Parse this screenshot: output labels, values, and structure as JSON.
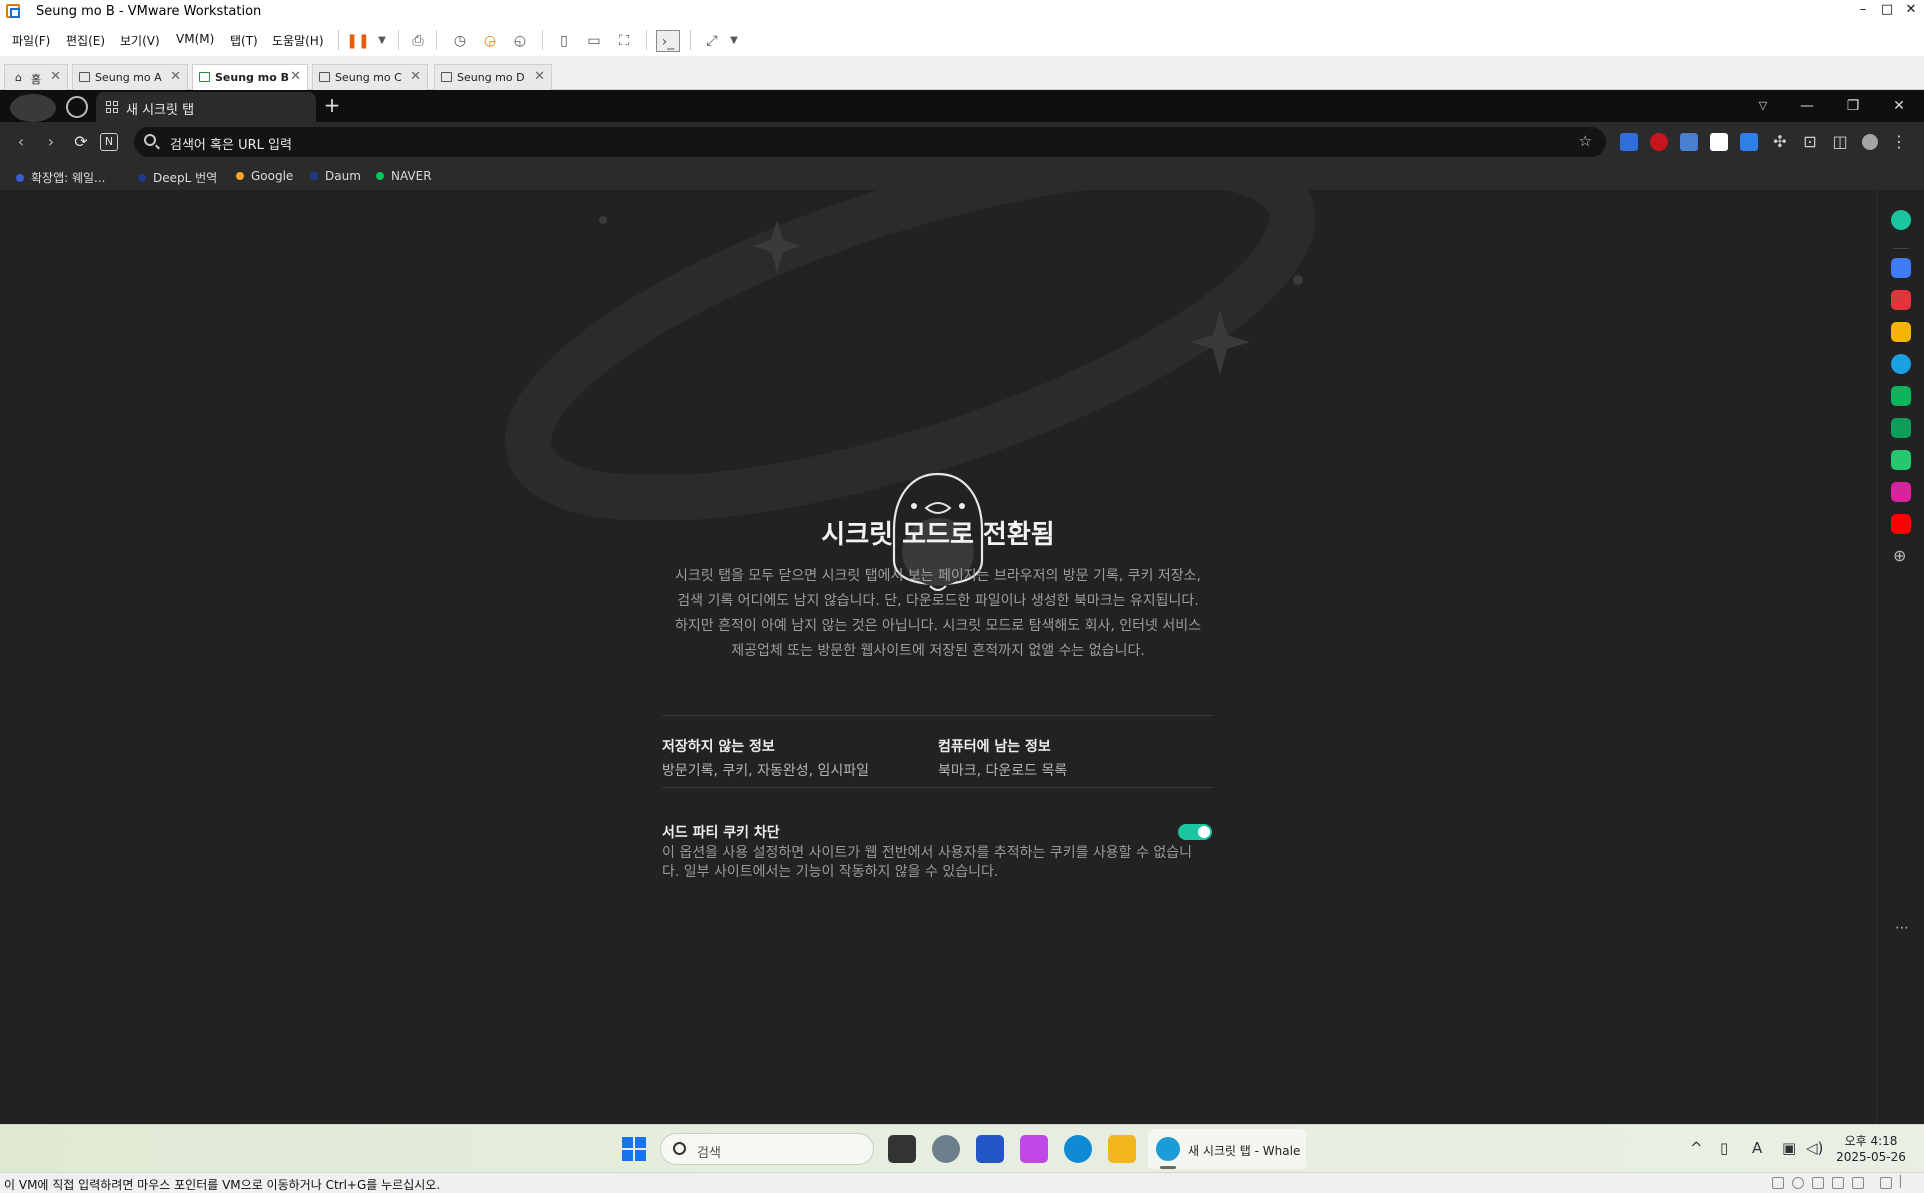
{
  "vmware": {
    "window_title": "Seung mo B - VMware Workstation",
    "menu": [
      "파일(F)",
      "편집(E)",
      "보기(V)",
      "VM(M)",
      "탭(T)",
      "도움말(H)"
    ],
    "tabs": [
      {
        "label": "홈"
      },
      {
        "label": "Seung mo A"
      },
      {
        "label": "Seung mo B",
        "active": true
      },
      {
        "label": "Seung mo C"
      },
      {
        "label": "Seung mo D"
      }
    ],
    "status_text": "이 VM에 직접 입력하려면 마우스 포인터를 VM으로 이동하거나 Ctrl+G를 누르십시오."
  },
  "browser": {
    "tab_title": "새 시크릿 탭",
    "url_placeholder": "검색어 혹은 URL 입력",
    "bookmarks": [
      {
        "label": "확장앱: 웨일...",
        "color": "#3b5bd9"
      },
      {
        "label": "DeepL 번역",
        "color": "#1e3a8a"
      },
      {
        "label": "Google",
        "color": "#f5a623"
      },
      {
        "label": "Daum",
        "color": "#1e3a8a"
      },
      {
        "label": "NAVER",
        "color": "#03c75a"
      }
    ],
    "incognito": {
      "heading": "시크릿 모드로 전환됨",
      "description_lines": [
        "시크릿 탭을 모두 닫으면 시크릿 탭에서 보는 페이지는 브라우저의 방문 기록, 쿠키 저장소,",
        "검색 기록 어디에도 남지 않습니다. 단, 다운로드한 파일이나 생성한 북마크는 유지됩니다.",
        "하지만 흔적이 아예 남지 않는 것은 아닙니다. 시크릿 모드로 탐색해도 회사, 인터넷 서비스",
        "제공업체 또는 방문한 웹사이트에 저장된 흔적까지 없앨 수는 없습니다."
      ],
      "not_saved_title": "저장하지 않는 정보",
      "not_saved_value": "방문기록, 쿠키, 자동완성, 임시파일",
      "kept_title": "컴퓨터에 남는 정보",
      "kept_value": "북마크, 다운로드 목록",
      "cookie_title": "서드 파티 쿠키 차단",
      "cookie_desc_lines": [
        "이 옵션을 사용 설정하면 사이트가 웹 전반에서 사용자를 추적하는 쿠키를 사용할 수 없습니",
        "다. 일부 사이트에서는 기능이 작동하지 않을 수 있습니다."
      ],
      "cookie_toggle_on": true,
      "toggle_color": "#19c6a0"
    }
  },
  "taskbar": {
    "search_label": "검색",
    "active_app_label": "새 시크릿 탭 - Whale",
    "time": "오후 4:18",
    "date": "2025-05-26"
  }
}
